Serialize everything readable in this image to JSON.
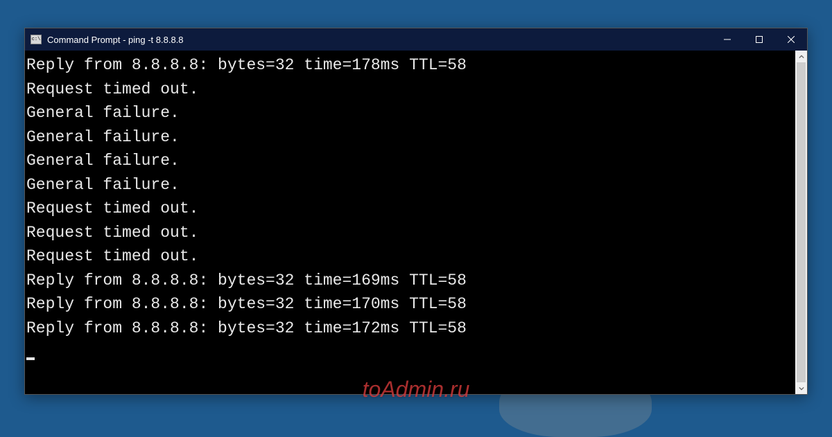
{
  "window": {
    "title": "Command Prompt - ping  -t 8.8.8.8"
  },
  "terminal": {
    "lines": [
      "Reply from 8.8.8.8: bytes=32 time=178ms TTL=58",
      "Request timed out.",
      "General failure.",
      "General failure.",
      "General failure.",
      "General failure.",
      "Request timed out.",
      "Request timed out.",
      "Request timed out.",
      "Reply from 8.8.8.8: bytes=32 time=169ms TTL=58",
      "Reply from 8.8.8.8: bytes=32 time=170ms TTL=58",
      "Reply from 8.8.8.8: bytes=32 time=172ms TTL=58"
    ]
  },
  "watermark": "toAdmin.ru"
}
